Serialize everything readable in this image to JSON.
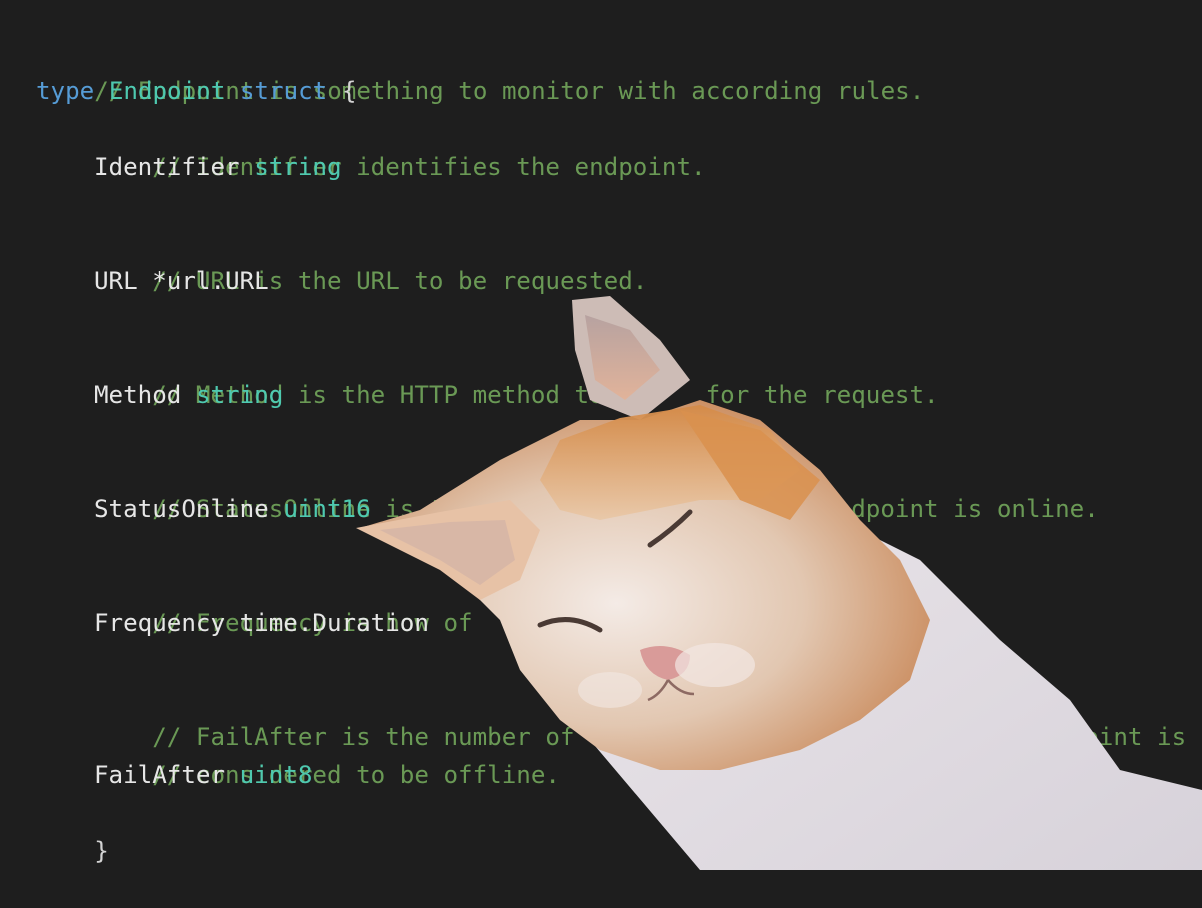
{
  "editor": {
    "lines": {
      "l1": {
        "comment": "// Endpoint is something to monitor with according rules."
      },
      "l2": {
        "kw_type": "type",
        "name": "Endpoint",
        "kw_struct": "struct",
        "brace": "{"
      },
      "l3": {
        "comment": "// Identifier identifies the endpoint."
      },
      "l4": {
        "field": "Identifier",
        "type": "string"
      },
      "l5": {
        "comment": "// URL is the URL to be requested."
      },
      "l6": {
        "field": "URL",
        "type": "*url.URL"
      },
      "l7": {
        "comment_a": "// Method is the HTTP method to b",
        "comment_b": "for the request."
      },
      "l8": {
        "field": "Method",
        "type": "string"
      },
      "l9": {
        "comment_a": "// StatusOnline is the status i",
        "comment_b": "e endpoint is online."
      },
      "l10": {
        "field": "StatusOnline",
        "type": "uint16"
      },
      "l11": {
        "comment": "// Frequency is how of"
      },
      "l12": {
        "field": "Frequency",
        "type": "time.Duration"
      },
      "l13": {
        "comment_a": "// FailAfter is the number of",
        "comment_b": "dpoint is"
      },
      "l14": {
        "comment": "// considered to be offline."
      },
      "l15": {
        "field": "FailAfter",
        "type": "uint8"
      },
      "l16": {
        "brace": "}"
      }
    }
  },
  "theme": {
    "background": "#1e1e1e",
    "comment": "#6a9955",
    "keyword": "#569cd6",
    "type": "#4ec9b0",
    "identifier": "#e6e6e6"
  },
  "overlay": {
    "icon": "cat-photo"
  }
}
